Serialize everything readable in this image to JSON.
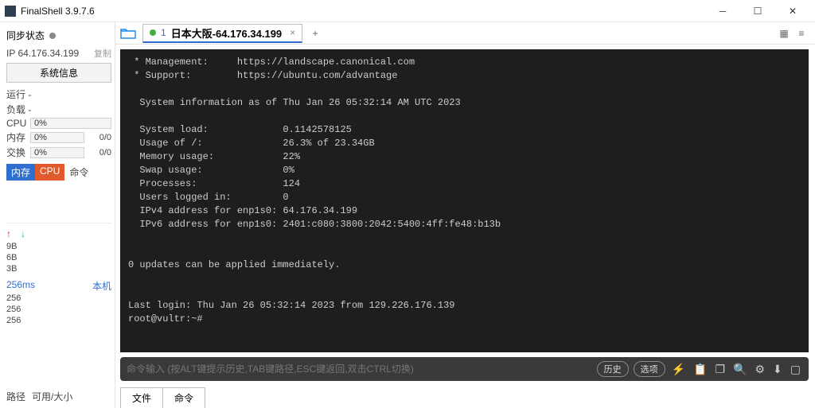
{
  "window": {
    "title": "FinalShell 3.9.7.6"
  },
  "sidebar": {
    "sync_label": "同步状态",
    "ip": "IP 64.176.34.199",
    "copy_label": "复制",
    "sysinfo_btn": "系统信息",
    "running": "运行 -",
    "load": "负载 -",
    "stats": {
      "cpu_label": "CPU",
      "cpu_val": "0%",
      "mem_label": "内存",
      "mem_val": "0%",
      "mem_right": "0/0",
      "swap_label": "交换",
      "swap_val": "0%",
      "swap_right": "0/0"
    },
    "tabs": {
      "mem": "内存",
      "cpu": "CPU",
      "cmd": "命令"
    },
    "nums": [
      "9B",
      "6B",
      "3B"
    ],
    "latency": "256ms",
    "local": "本机",
    "lat_nums": [
      "256",
      "256",
      "256"
    ],
    "bottom": {
      "path": "路径",
      "avail": "可用/大小"
    }
  },
  "session": {
    "num": "1",
    "name": "日本大阪-64.176.34.199"
  },
  "terminal": {
    "lines": " * Management:     https://landscape.canonical.com\n * Support:        https://ubuntu.com/advantage\n\n  System information as of Thu Jan 26 05:32:14 AM UTC 2023\n\n  System load:             0.1142578125\n  Usage of /:              26.3% of 23.34GB\n  Memory usage:            22%\n  Swap usage:              0%\n  Processes:               124\n  Users logged in:         0\n  IPv4 address for enp1s0: 64.176.34.199\n  IPv6 address for enp1s0: 2401:c080:3800:2042:5400:4ff:fe48:b13b\n\n\n0 updates can be applied immediately.\n\n\nLast login: Thu Jan 26 05:32:14 2023 from 129.226.176.139\nroot@vultr:~#"
  },
  "cmdbar": {
    "placeholder": "命令输入 (按ALT键提示历史,TAB键路径,ESC键返回,双击CTRL切换)",
    "history": "历史",
    "options": "选项"
  },
  "bottom_tabs": {
    "file": "文件",
    "cmd": "命令"
  }
}
